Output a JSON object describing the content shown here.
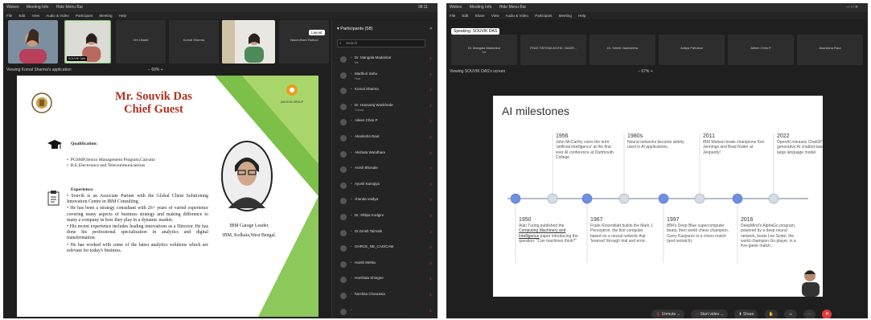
{
  "left": {
    "titlebar": {
      "app": "Webex",
      "meeting_info": "Meeting Info",
      "hide_menu": "Hide Menu Bar",
      "clock": "08:11"
    },
    "menu": [
      "File",
      "Edit",
      "View",
      "Audio & Video",
      "Participant",
      "Meeting",
      "Help"
    ],
    "strip": [
      {
        "name": "",
        "cam": true
      },
      {
        "name": "SOUVIK DAS",
        "cam": true
      },
      {
        "name": "Om Ukade",
        "cam": false
      },
      {
        "name": "Komal Sharma",
        "cam": false
      },
      {
        "name": "",
        "cam": true
      },
      {
        "name": "Vasundhara Rathod",
        "cam": false
      }
    ],
    "layout_label": "Layout",
    "viewing": "Viewing Komal Sharma's application",
    "zoom": "69%",
    "slide": {
      "title_line1": "Mr. Souvik Das",
      "title_line2": "Chief Guest",
      "logo_right": "DAYSON GROUP",
      "qual_heading": "Qualification:",
      "quals": [
        "PGSMP,Senior Management Program,Calcutta",
        "B.E,Electronics and Telecommunications"
      ],
      "exp_heading": "Experience:",
      "exp": [
        "Souvik is an Associate Partner with the Global Client Solutioning Innovation Centre in IBM Consulting.",
        "He has been a strategy consultant with 26+ years of varied experience covering many aspects of business strategy and making difference to many a company in how they play in a dynamic market.",
        "His recent experience includes leading innovations as a Director. He has done his professional specialization in analytics and digital transformation.",
        "He has worked with some of the latest analytics solutions which are relevant for today's business."
      ],
      "caption_line1": "IBM Garage Leader,",
      "caption_line2": "IBM, Kolkata,West Bengal."
    },
    "participants": {
      "header": "Participants (58)",
      "search_placeholder": "Search",
      "list": [
        {
          "name": "Dr. Mangala Madankar",
          "role": "Me"
        },
        {
          "name": "Madhuri Sahu",
          "role": "Host"
        },
        {
          "name": "Komal Sharma",
          "role": ""
        },
        {
          "name": "Dr. Hansaraj Wankhede",
          "role": "Cohost"
        },
        {
          "name": "Aileen Chris P",
          "role": ""
        },
        {
          "name": "Akanksha Raut",
          "role": ""
        },
        {
          "name": "Akshata Wandhare",
          "role": ""
        },
        {
          "name": "Anish Bhosale",
          "role": ""
        },
        {
          "name": "Ayush Kanojiya",
          "role": ""
        },
        {
          "name": "chanda vaidya",
          "role": ""
        },
        {
          "name": "Dr. Shilpa Kodgire",
          "role": ""
        },
        {
          "name": "Dr.Girish Talmale",
          "role": ""
        },
        {
          "name": "GHRCE_NE_CAD/CAM",
          "role": ""
        },
        {
          "name": "Harsh Mehta",
          "role": ""
        },
        {
          "name": "Harshala Shingne",
          "role": ""
        },
        {
          "name": "harshita Chourasia",
          "role": ""
        },
        {
          "name": "",
          "role": ""
        }
      ]
    }
  },
  "right": {
    "titlebar": {
      "app": "Webex",
      "meeting_info": "Meeting Info",
      "hide_menu": "Hide Menu Bar"
    },
    "menu": [
      "File",
      "Edit",
      "Share",
      "View",
      "Audio & Video",
      "Participant",
      "Meeting",
      "Help"
    ],
    "speaking": "Speaking: SOUVIK DAS",
    "strip": [
      {
        "name": "Dr. Mangala Madankar",
        "role": "Me"
      },
      {
        "name": "ITNAT FATEMA MOHD. NAZIR...",
        "role": ""
      },
      {
        "name": "Dr. Srishti Vashishtha",
        "role": ""
      },
      {
        "name": "Aditya Pahulkar",
        "role": ""
      },
      {
        "name": "Aileen Chris P",
        "role": ""
      },
      {
        "name": "Akanksha Raut",
        "role": ""
      }
    ],
    "viewing": "Viewing SOUVIK DAS's screen",
    "zoom": "67%",
    "slide": {
      "title": "AI milestones",
      "top": [
        {
          "year": "1956",
          "text": "John McCarthy coins the term 'artificial intelligence' at the first-ever AI conference at Dartmouth College."
        },
        {
          "year": "1980s",
          "text": "Neural networks become widely used in AI applications."
        },
        {
          "year": "2011",
          "text": "IBM Watson beats champions Ken Jennings and Brad Rutter at Jeopardy!"
        },
        {
          "year": "2022",
          "text": "OpenAI releases ChatGPT, a generative AI chatbot based on a large language model."
        }
      ],
      "bottom": [
        {
          "year": "1950",
          "pre": "Alan Turing published the ",
          "link": "Computing Machinery and Intelligence",
          "post": " paper introducing the question: \"Can machines think?\""
        },
        {
          "year": "1967",
          "pre": "Frank Rosenblatt builds the Mark 1 Perceptron, the first computer based on a neural network that 'learned' through trial and error.",
          "link": "",
          "post": ""
        },
        {
          "year": "1997",
          "pre": "IBM's Deep Blue supercomputer beats, then world chess champion, Garry Kasparov in a chess match (and rematch).",
          "link": "",
          "post": ""
        },
        {
          "year": "2016",
          "pre": "DeepMind's AlphaGo program, powered by a deep neural network, beats Lee Sedol, the world champion Go player, in a five-game match.",
          "link": "",
          "post": ""
        }
      ]
    },
    "controls": {
      "unmute": "Unmute",
      "video": "Start video",
      "share": "Share",
      "more": "···"
    }
  },
  "colors": {
    "accent_blue": "#6f8fe0",
    "node_gray": "#d6dbe6",
    "mute_red": "#e04040",
    "title_red": "#b0301f"
  }
}
